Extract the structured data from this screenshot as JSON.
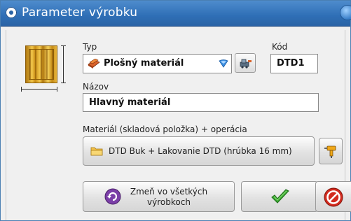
{
  "window": {
    "title": "Parameter výrobku"
  },
  "form": {
    "type_label": "Typ",
    "type_value": "Plošný materiál",
    "code_label": "Kód",
    "code_value": "DTD1",
    "name_label": "Názov",
    "name_value": "Hlavný materiál",
    "material_label": "Materiál (skladová položka) + operácia",
    "material_value": "DTD Buk + Lakovanie DTD  (hrúbka 16 mm)"
  },
  "buttons": {
    "change_all_line1": "Zmeň vo všetkých",
    "change_all_line2": "výrobkoch"
  },
  "icons": {
    "product_preview": "wood-board-icon",
    "type_select": "plank-material-icon",
    "type_picker": "machine-icon",
    "material_folder": "folder-icon",
    "material_tool": "drill-icon",
    "change_all": "refresh-arrow-icon",
    "ok": "checkmark-icon",
    "cancel": "no-entry-icon"
  },
  "colors": {
    "titlebar": "#2f6fb6",
    "ok_green": "#3aa832",
    "cancel_red": "#d22a1e"
  }
}
